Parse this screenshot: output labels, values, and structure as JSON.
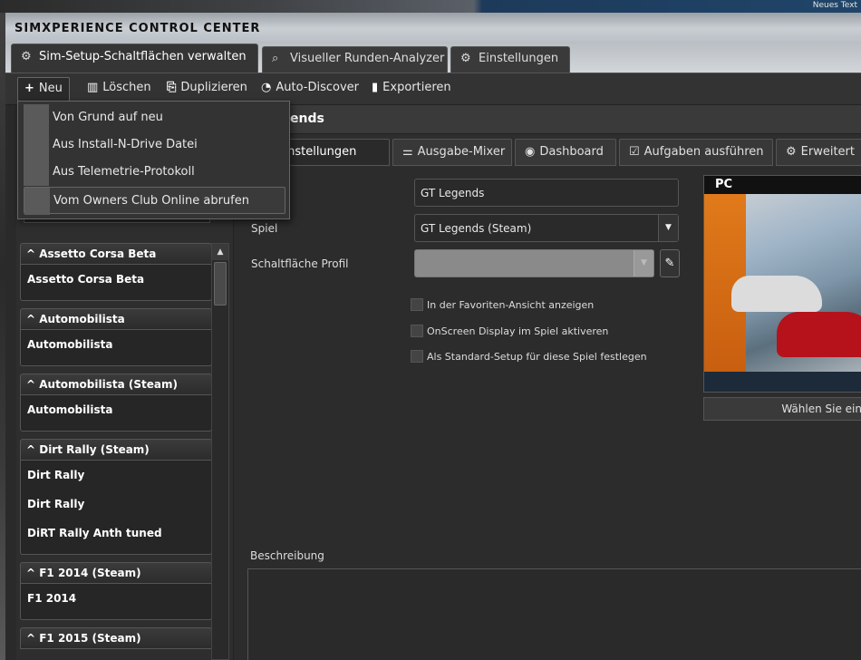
{
  "desktop": {
    "corner_text": "Neues Text"
  },
  "app": {
    "title": "SIMXPERIENCE CONTROL CENTER"
  },
  "tabs": [
    {
      "label": "Sim-Setup-Schaltflächen verwalten",
      "icon": "settings-buttons-icon"
    },
    {
      "label": "Visueller Runden-Analyzer",
      "icon": "analyzer-icon"
    },
    {
      "label": "Einstellungen",
      "icon": "gears-icon"
    }
  ],
  "toolbar": {
    "new": "Neu",
    "delete": "Löschen",
    "duplicate": "Duplizieren",
    "autodiscover": "Auto-Discover",
    "export": "Exportieren"
  },
  "menu": {
    "items": [
      "Von Grund auf neu",
      "Aus Install-N-Drive Datei",
      "Aus Telemetrie-Protokoll",
      "Vom Owners Club Online abrufen"
    ]
  },
  "header": {
    "title_partial": "ends"
  },
  "subtabs": [
    {
      "label": "ndeinstellungen"
    },
    {
      "label": "Ausgabe-Mixer",
      "icon": "mixer-icon"
    },
    {
      "label": "Dashboard",
      "icon": "dashboard-icon"
    },
    {
      "label": "Aufgaben ausführen",
      "icon": "tasks-icon"
    },
    {
      "label": "Erweitert",
      "icon": "advanced-icon"
    }
  ],
  "form": {
    "name_value": "GT Legends",
    "spiel_label": "Spiel",
    "spiel_value": "GT Legends (Steam)",
    "profile_label": "Schaltfläche Profil",
    "profile_value": "",
    "checkboxes": [
      "In der Favoriten-Ansicht anzeigen",
      "OnScreen Display im Spiel aktiveren",
      "Als Standard-Setup für diese Spiel festlegen"
    ],
    "desc_label": "Beschreibung"
  },
  "cover": {
    "platform": "PC",
    "choose_label": "Wählen Sie ein"
  },
  "list": {
    "groups": [
      {
        "header": "Assetto Corsa Beta",
        "items": [
          "Assetto Corsa Beta"
        ]
      },
      {
        "header": "Automobilista",
        "items": [
          "Automobilista"
        ]
      },
      {
        "header": "Automobilista (Steam)",
        "items": [
          "Automobilista"
        ]
      },
      {
        "header": "Dirt Rally (Steam)",
        "items": [
          "Dirt Rally",
          "Dirt Rally",
          "DiRT Rally Anth tuned"
        ]
      },
      {
        "header": "F1 2014 (Steam)",
        "items": [
          "F1 2014"
        ]
      },
      {
        "header": "F1 2015 (Steam)",
        "items": []
      }
    ]
  },
  "colors": {
    "accent_orange": "#e07a1a",
    "window_bg": "#2c2c2c"
  }
}
